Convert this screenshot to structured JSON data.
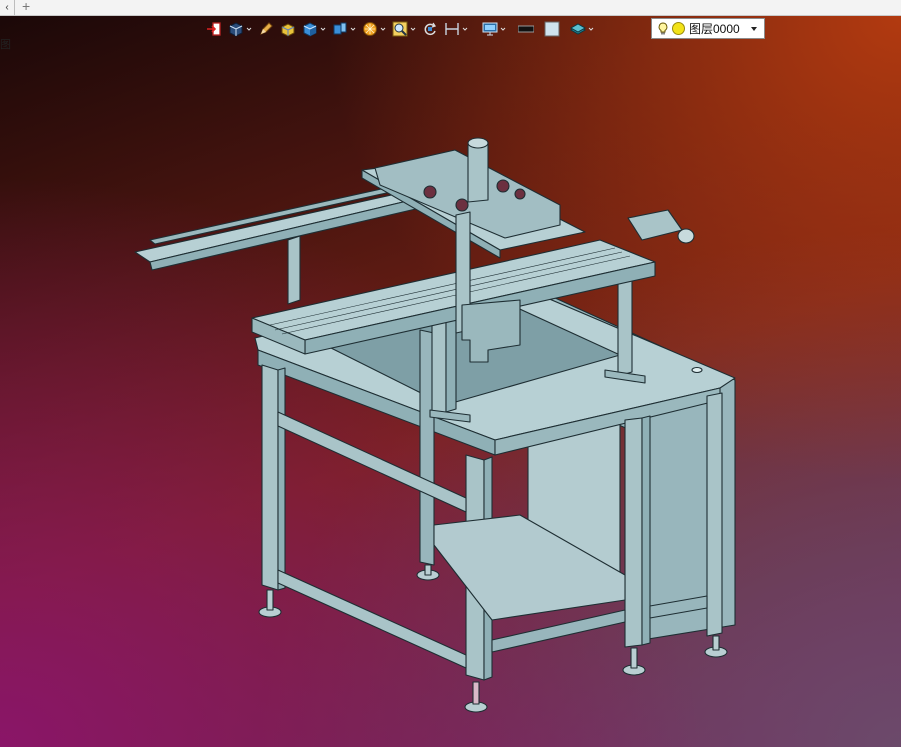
{
  "tabbar": {
    "left_glyph": "‹",
    "add_glyph": "+"
  },
  "side_char": "图",
  "toolbar": {
    "buttons": [
      {
        "name": "exit-sketch-button",
        "icon": "exit-icon",
        "dropdown": false
      },
      {
        "name": "view-orientation-button",
        "icon": "view-cube-icon",
        "dropdown": true
      },
      {
        "name": "pencil-button",
        "icon": "pencil-icon",
        "dropdown": false
      },
      {
        "name": "box-solid-button",
        "icon": "box-icon",
        "dropdown": false
      },
      {
        "name": "shaded-display-button",
        "icon": "shaded-cube-icon",
        "dropdown": true
      },
      {
        "name": "section-view-button",
        "icon": "section-icon",
        "dropdown": true
      },
      {
        "name": "render-style-button",
        "icon": "render-icon",
        "dropdown": true
      },
      {
        "name": "zoom-button",
        "icon": "zoom-icon",
        "dropdown": true
      },
      {
        "name": "rotate-button",
        "icon": "rotate-icon",
        "dropdown": false
      },
      {
        "name": "dimension-button",
        "icon": "dimension-icon",
        "dropdown": true
      },
      {
        "name": "display-settings-button",
        "icon": "monitor-icon",
        "dropdown": true
      },
      {
        "name": "color-black-button",
        "icon": "black-swatch-icon",
        "dropdown": false
      },
      {
        "name": "color-light-button",
        "icon": "light-swatch-icon",
        "dropdown": false
      },
      {
        "name": "layer-manager-button",
        "icon": "layers-icon",
        "dropdown": true
      }
    ]
  },
  "layer": {
    "name": "图层0000",
    "bulb_color": "#f2e218"
  },
  "colors": {
    "model_fill": "#a9c4c8",
    "model_fill_dark": "#8fb0b6",
    "model_edge": "#1e2e33"
  }
}
